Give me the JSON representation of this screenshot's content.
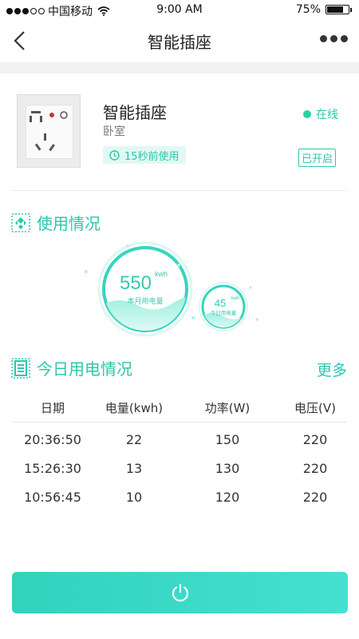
{
  "status_bar": {
    "carrier": "中国移动",
    "time": "9:00 AM",
    "battery": "75%"
  },
  "nav": {
    "title": "智能插座"
  },
  "device": {
    "name": "智能插座",
    "room": "卧室",
    "last_used": "15秒前使用",
    "online_label": "在线",
    "switch_state": "已开启"
  },
  "usage": {
    "title": "使用情况",
    "month_value": "550",
    "month_unit": "kwh",
    "month_label": "本月用电量",
    "today_value": "45",
    "today_unit": "kwh",
    "today_label": "今日用电量"
  },
  "today_table": {
    "title": "今日用电情况",
    "more_label": "更多",
    "columns": [
      "日期",
      "电量(kwh)",
      "功率(W)",
      "电压(V)"
    ],
    "rows": [
      [
        "20:36:50",
        "22",
        "150",
        "220"
      ],
      [
        "15:26:30",
        "13",
        "130",
        "220"
      ],
      [
        "10:56:45",
        "10",
        "120",
        "220"
      ]
    ]
  },
  "colors": {
    "accent": "#2cc6ad",
    "button_gradient_start": "#31d3bd",
    "button_gradient_end": "#45e0d0"
  },
  "icons": {
    "back": "chevron-left-icon",
    "more": "more-dots-icon",
    "clock": "clock-icon",
    "usage": "usage-icon",
    "document": "document-icon",
    "power": "power-icon"
  }
}
